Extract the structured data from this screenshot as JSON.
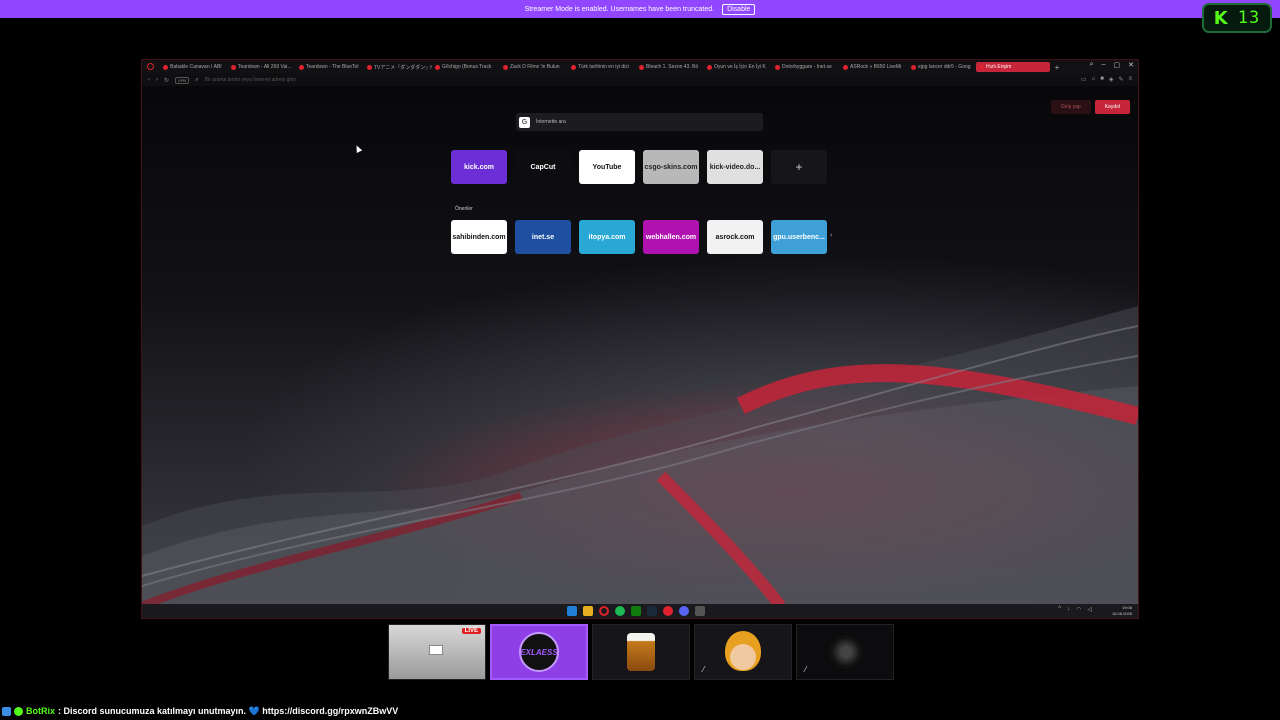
{
  "banner": {
    "text": "Streamer Mode is enabled. Usernames have been truncated.",
    "button": "Disable"
  },
  "kick_badge": {
    "icon": "kick-logo-icon",
    "count": "13"
  },
  "browser": {
    "tabs": [
      {
        "label": "Babakle Canavarı I ABI"
      },
      {
        "label": "Teardown - All 269 Vai..."
      },
      {
        "label": "Teardown - The BlueTol"
      },
      {
        "label": "TVアニメ『ダンダダン』HAYA"
      },
      {
        "label": "G/Ichigo (Bonus Track"
      },
      {
        "label": "Zack D Films 'in Bulun"
      },
      {
        "label": "Türk tarihinin en iyi dizi"
      },
      {
        "label": "Bleach 1. Sezon 43. Bö"
      },
      {
        "label": "Oyun ve İş İçin En İyi K"
      },
      {
        "label": "Dotorbyggare - Inet.se"
      },
      {
        "label": "ASRock » B650 LiveMi"
      },
      {
        "label": "ejpg lancer ddr5 - Goog"
      },
      {
        "label": "Hızlı Erişim"
      }
    ],
    "address_placeholder": "Bir arama terimi veya İnternet adresi girin",
    "vpn_label": "VPN",
    "login_buttons": [
      "Giriş yap",
      "Kaydol"
    ],
    "search_placeholder": "İnternette ara",
    "speed_dial": [
      {
        "label": "kick.com",
        "bg": "#6c2fd6",
        "fg": "#ffffff"
      },
      {
        "label": "CapCut",
        "bg": "#0d0d10",
        "fg": "#ffffff"
      },
      {
        "label": "YouTube",
        "bg": "#ffffff",
        "fg": "#111111"
      },
      {
        "label": "csgo-skins.com",
        "bg": "#b8b8b8",
        "fg": "#222222"
      },
      {
        "label": "kick-video.do...",
        "bg": "#e0e0e0",
        "fg": "#222222"
      },
      {
        "label": "+",
        "bg": "#16161a",
        "fg": "#cccccc"
      }
    ],
    "suggestions_label": "Öneriler",
    "suggestions": [
      {
        "label": "sahibinden.com",
        "bg": "#ffffff",
        "fg": "#111111"
      },
      {
        "label": "inet.se",
        "bg": "#1e4fa0",
        "fg": "#ffffff"
      },
      {
        "label": "itopya.com",
        "bg": "#29a8d6",
        "fg": "#ffffff"
      },
      {
        "label": "webhallen.com",
        "bg": "#b012b0",
        "fg": "#ffffff"
      },
      {
        "label": "asrock.com",
        "bg": "#f2f2f2",
        "fg": "#111111"
      },
      {
        "label": "gpu.userbenc...",
        "bg": "#3ea0d6",
        "fg": "#ffffff"
      }
    ],
    "clock": {
      "time": "19:08",
      "date": "16.08.2026"
    }
  },
  "thumbs": [
    {
      "name": "desktop",
      "live": "LIVE"
    },
    {
      "name": "exlaess",
      "text": "EXLAESS"
    },
    {
      "name": "beer"
    },
    {
      "name": "naruto"
    },
    {
      "name": "dark"
    }
  ],
  "chat": {
    "user": "BotRix",
    "message": ": Discord sunucumuza katılmayı unutmayın. 💙 https://discord.gg/rpxwnZBwVV"
  },
  "colors": {
    "accent": "#9147ff",
    "kick_green": "#53fc18",
    "opera_red": "#c6253a"
  }
}
